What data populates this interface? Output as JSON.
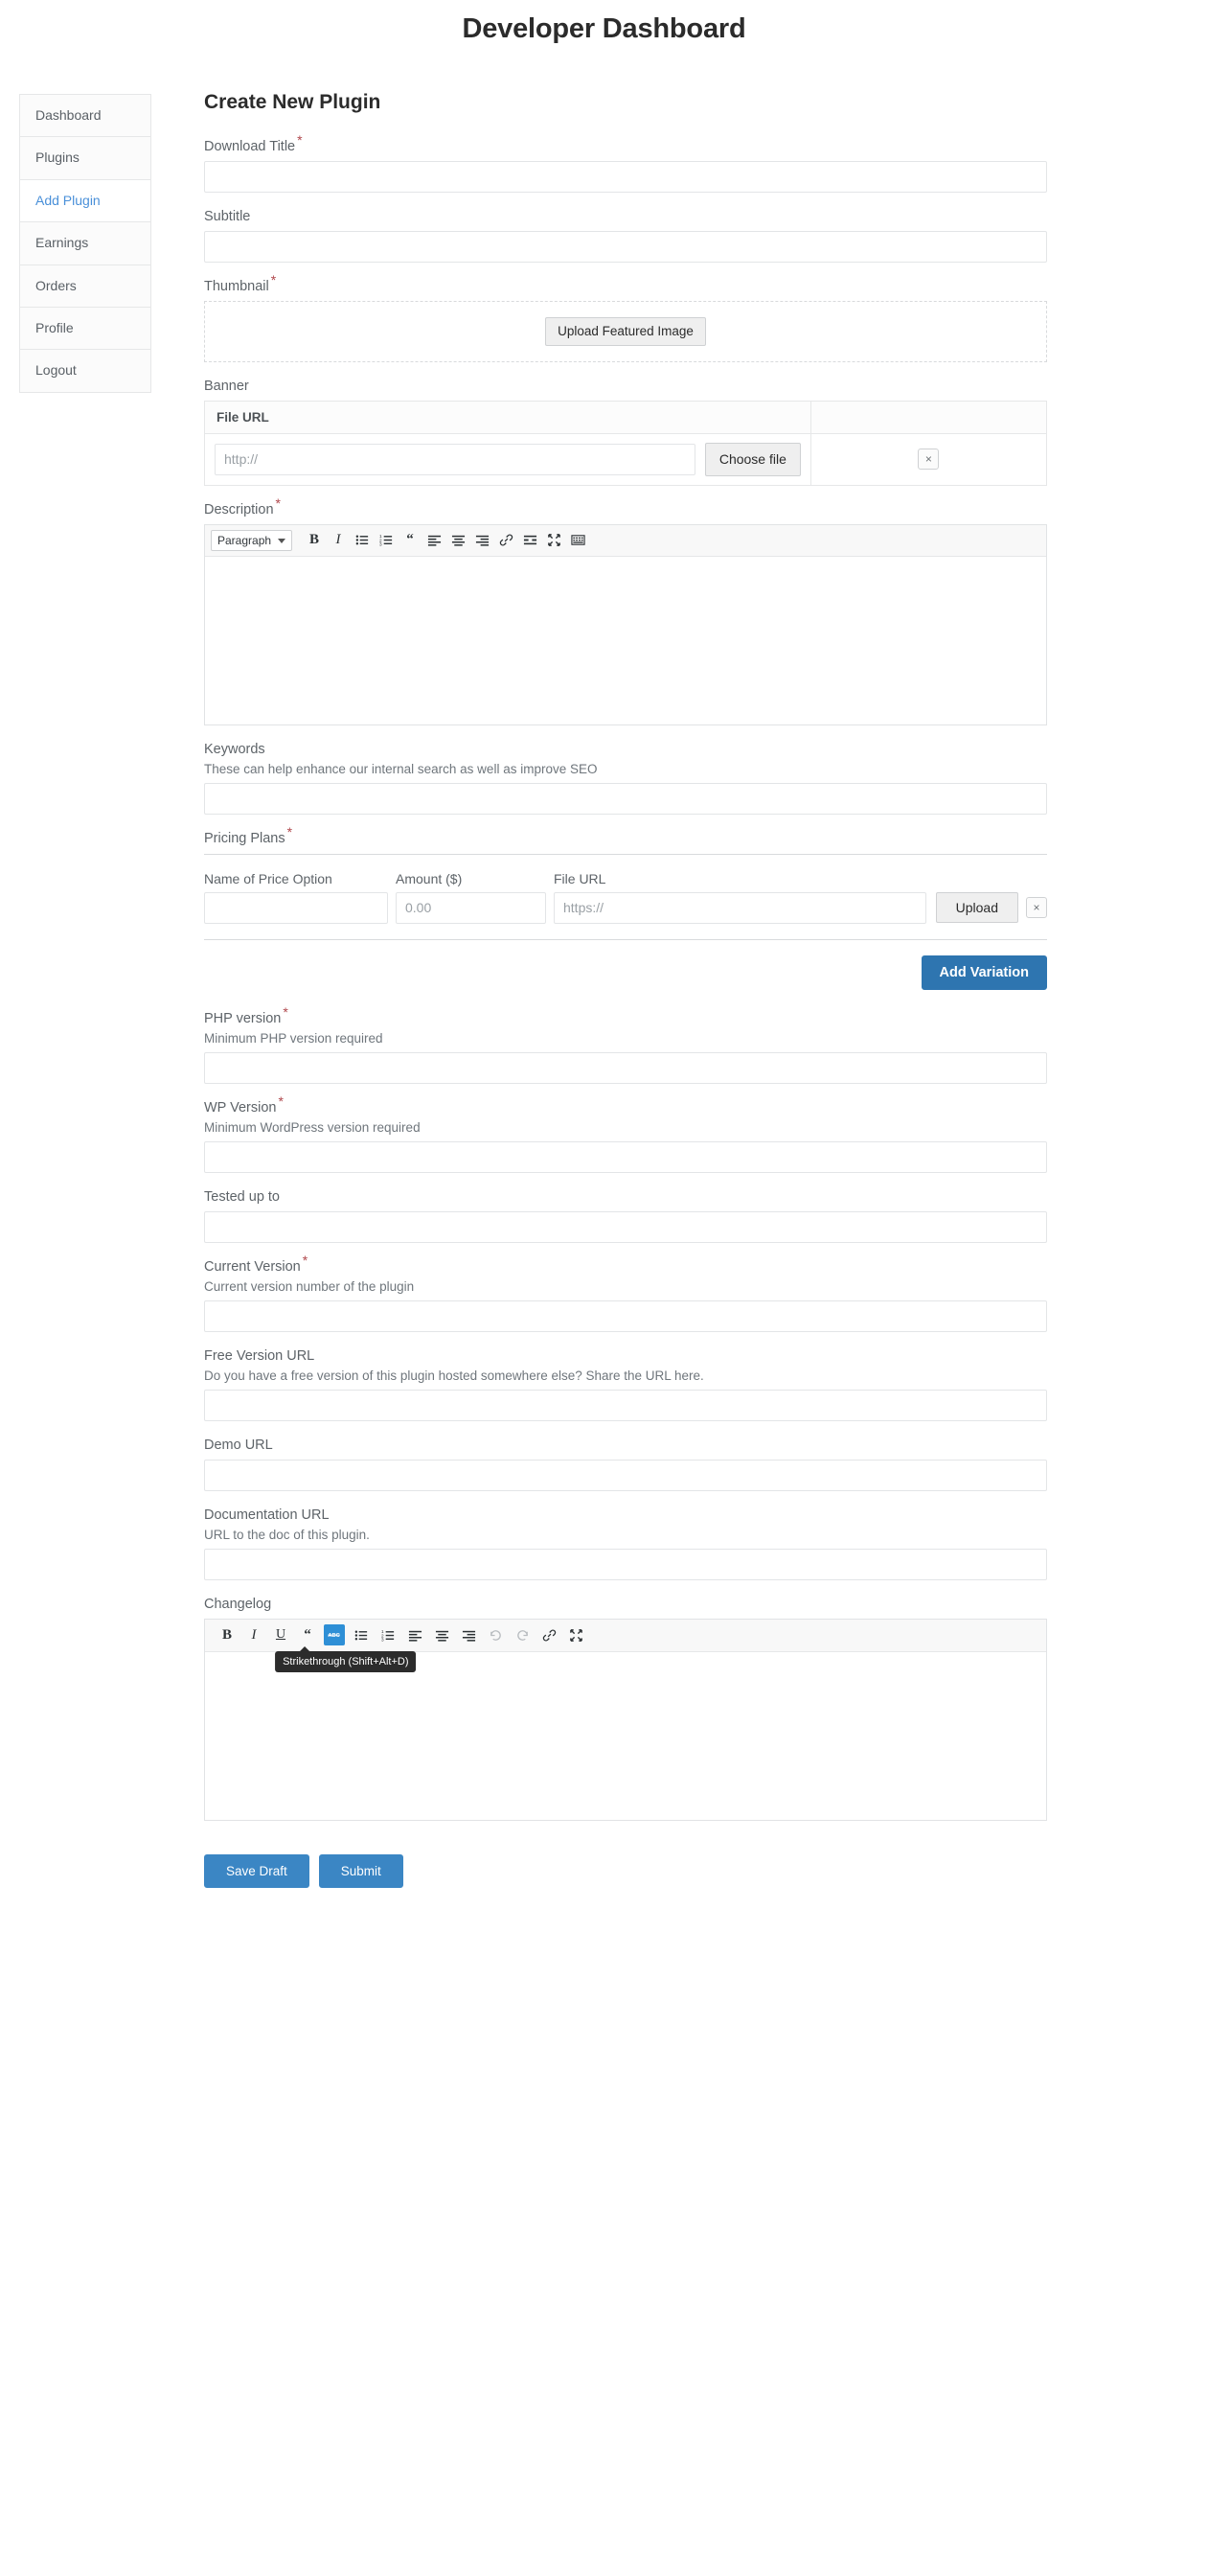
{
  "header": {
    "title": "Developer Dashboard"
  },
  "sidebar": {
    "items": [
      {
        "label": "Dashboard",
        "active": false
      },
      {
        "label": "Plugins",
        "active": false
      },
      {
        "label": "Add Plugin",
        "active": true
      },
      {
        "label": "Earnings",
        "active": false
      },
      {
        "label": "Orders",
        "active": false
      },
      {
        "label": "Profile",
        "active": false
      },
      {
        "label": "Logout",
        "active": false
      }
    ]
  },
  "main": {
    "title": "Create New Plugin",
    "fields": {
      "download_title": {
        "label": "Download Title",
        "required": "*",
        "value": "",
        "placeholder": ""
      },
      "subtitle": {
        "label": "Subtitle",
        "required": "",
        "value": "",
        "placeholder": ""
      },
      "thumbnail": {
        "label": "Thumbnail",
        "required": "*",
        "upload_button": "Upload Featured Image"
      },
      "banner": {
        "label": "Banner",
        "col_file_url": "File URL",
        "col_actions": "",
        "url_placeholder": "http://",
        "choose_file_label": "Choose file",
        "remove_label": "×"
      },
      "description": {
        "label": "Description",
        "required": "*",
        "format_value": "Paragraph",
        "format_options": [
          "Paragraph"
        ],
        "content": ""
      },
      "keywords": {
        "label": "Keywords",
        "help": "These can help enhance our internal search as well as improve SEO",
        "value": ""
      },
      "pricing_plans": {
        "label": "Pricing Plans",
        "required": "*",
        "col_name": "Name of Price Option",
        "col_amount": "Amount ($)",
        "col_file_url": "File URL",
        "name_value": "",
        "amount_placeholder": "0.00",
        "file_url_placeholder": "https://",
        "upload_label": "Upload",
        "remove_label": "×",
        "add_variation_label": "Add Variation"
      },
      "php_version": {
        "label": "PHP version",
        "required": "*",
        "help": "Minimum PHP version required",
        "value": ""
      },
      "wp_version": {
        "label": "WP Version",
        "required": "*",
        "help": "Minimum WordPress version required",
        "value": ""
      },
      "tested_up_to": {
        "label": "Tested up to",
        "required": "",
        "value": ""
      },
      "current_version": {
        "label": "Current Version",
        "required": "*",
        "help": "Current version number of the plugin",
        "value": ""
      },
      "free_version_url": {
        "label": "Free Version URL",
        "required": "",
        "help": "Do you have a free version of this plugin hosted somewhere else? Share the URL here.",
        "value": ""
      },
      "demo_url": {
        "label": "Demo URL",
        "required": "",
        "value": ""
      },
      "documentation_url": {
        "label": "Documentation URL",
        "required": "",
        "help": "URL to the doc of this plugin.",
        "value": ""
      },
      "changelog": {
        "label": "Changelog",
        "required": "",
        "content": "",
        "tooltip": "Strikethrough (Shift+Alt+D)"
      }
    },
    "actions": {
      "save_draft": "Save Draft",
      "submit": "Submit"
    }
  },
  "colors": {
    "accent_blue": "#2e75b0",
    "submit_blue": "#3b86c4",
    "active_link": "#4a90d9",
    "required_red": "#b0474c",
    "toolbar_active": "#2e8fd6",
    "tooltip_bg": "#2c2c2c"
  }
}
